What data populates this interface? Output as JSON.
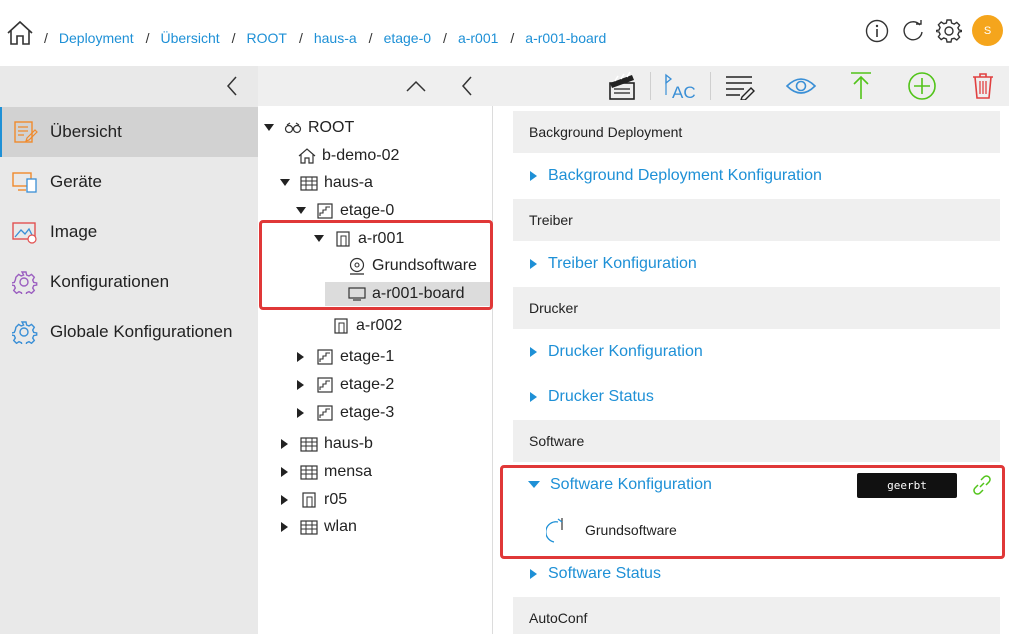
{
  "breadcrumbs": [
    "Deployment",
    "Übersicht",
    "ROOT",
    "haus-a",
    "etage-0",
    "a-r001",
    "a-r001-board"
  ],
  "breadcrumb_separator": "/",
  "user": {
    "avatar_initial": "S",
    "avatar_color": "#f5a51c"
  },
  "colors": {
    "accent": "#1e90d6",
    "highlight_box": "#e03838",
    "add": "#52c41a",
    "delete": "#e04040",
    "upload": "#52c41a"
  },
  "sidebar": {
    "items": [
      {
        "label": "Übersicht",
        "icon": "overview-icon",
        "active": true
      },
      {
        "label": "Geräte",
        "icon": "devices-icon"
      },
      {
        "label": "Image",
        "icon": "image-icon"
      },
      {
        "label": "Konfigurationen",
        "icon": "config-gear-icon"
      },
      {
        "label": "Globale Konfigurationen",
        "icon": "global-config-icon"
      }
    ]
  },
  "toolbar": {
    "icons": [
      "collapse-up-icon",
      "back-icon",
      "clapperboard-icon",
      "rename-ac-icon",
      "list-edit-icon",
      "eye-icon",
      "upload-icon",
      "add-icon",
      "delete-icon"
    ]
  },
  "tree": {
    "root": "ROOT",
    "nodes": {
      "b_demo_02": "b-demo-02",
      "haus_a": "haus-a",
      "etage_0": "etage-0",
      "a_r001": "a-r001",
      "grundsoftware": "Grundsoftware",
      "a_r001_board": "a-r001-board",
      "a_r002": "a-r002",
      "etage_1": "etage-1",
      "etage_2": "etage-2",
      "etage_3": "etage-3",
      "haus_b": "haus-b",
      "mensa": "mensa",
      "r05": "r05",
      "wlan": "wlan"
    }
  },
  "panel": {
    "sections": {
      "background": {
        "title": "Background Deployment",
        "links": [
          "Background Deployment Konfiguration"
        ]
      },
      "treiber": {
        "title": "Treiber",
        "links": [
          "Treiber Konfiguration"
        ]
      },
      "drucker": {
        "title": "Drucker",
        "links": [
          "Drucker Konfiguration",
          "Drucker Status"
        ]
      },
      "software": {
        "title": "Software",
        "links": [
          "Software Konfiguration",
          "Software Status"
        ]
      },
      "autoconf": {
        "title": "AutoConf"
      }
    },
    "software_badge": "geerbt",
    "software_item": "Grundsoftware"
  }
}
